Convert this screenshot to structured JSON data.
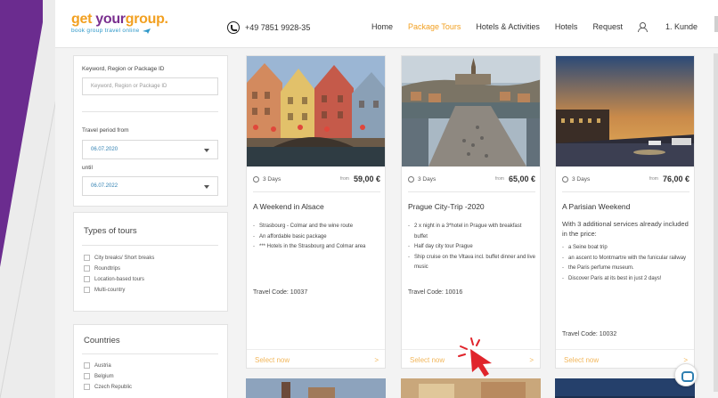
{
  "logo": {
    "part1": "get ",
    "part2": "your",
    "part3": "group.",
    "tagline": "book group travel online"
  },
  "header": {
    "phone": "+49 7851 9928-35",
    "nav": [
      "Home",
      "Package Tours",
      "Hotels & Activities",
      "Hotels",
      "Request"
    ],
    "active": "Package Tours",
    "user": "1. Kunde"
  },
  "sidebar": {
    "keyword_label": "Keyword, Region or Package ID",
    "keyword_placeholder": "Keyword, Region or Package ID",
    "period_from_label": "Travel period from",
    "period_from_value": "06.07.2020",
    "until_label": "until",
    "until_value": "06.07.2022",
    "types_title": "Types of tours",
    "types": [
      "City breaks/ Short breaks",
      "Roundtrips",
      "Location-based tours",
      "Multi-country"
    ],
    "countries_title": "Countries",
    "countries": [
      "Austria",
      "Belgium",
      "Czech Republic"
    ]
  },
  "cards": [
    {
      "days": "3 Days",
      "from": "from",
      "price": "59,00 €",
      "title": "A Weekend in Alsace",
      "intro": "",
      "items": [
        "Strasbourg - Colmar and the wine route",
        "An affordable basic package",
        "*** Hotels in the Strasbourg and Colmar area"
      ],
      "travel_code": "Travel Code: 10037",
      "select": "Select now",
      "chevron": ">"
    },
    {
      "days": "3 Days",
      "from": "from",
      "price": "65,00 €",
      "title": "Prague City-Trip -2020",
      "intro": "",
      "items": [
        "2 x night in a 3*hotel in Prague with breakfast buffet",
        "Half day city tour Prague",
        "Ship cruise on the Vltava incl. buffet dinner and live music"
      ],
      "travel_code": "Travel Code: 10016",
      "select": "Select now",
      "chevron": ">"
    },
    {
      "days": "3 Days",
      "from": "from",
      "price": "76,00 €",
      "title": "A Parisian Weekend",
      "intro": "With 3 additional services already included in the price:",
      "items": [
        "a Seine boat trip",
        "an ascent to Montmartre with the funicular railway",
        "the Paris perfume museum.",
        "Discover Paris at its best in just 2 days!"
      ],
      "travel_code": "Travel Code: 10032",
      "select": "Select now",
      "chevron": ">"
    }
  ],
  "icons": [
    "phone-icon",
    "user-icon",
    "clock-icon",
    "chat-icon",
    "click-pointer-icon"
  ],
  "colors": {
    "accent": "#f2a021",
    "brand_purple": "#7a2f8f",
    "link_blue": "#2e7fb1",
    "slide_purple": "#6b2c8f"
  }
}
